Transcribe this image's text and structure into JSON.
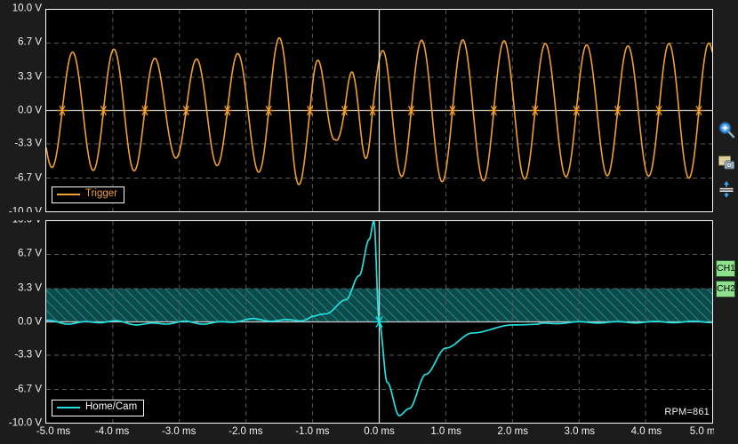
{
  "app": {
    "background_color": "#1c1c1c",
    "plot_background": "#000000"
  },
  "colors": {
    "trigger": "#f0a030",
    "home_cam": "#22e0e0",
    "grid": "#5a5a5a",
    "zero_line": "#c8c8c8",
    "cursor": "#d8d8d8",
    "band_fill": "#0d4a4a",
    "band_hatch": "#1f8c8c",
    "badge_green": "#8ee08e",
    "text": "#f2f2f2"
  },
  "axes": {
    "y_ticks": [
      "10.0 V",
      "6.7 V",
      "3.3 V",
      "0.0 V",
      "-3.3 V",
      "-6.7 V",
      "-10.0 V"
    ],
    "y_values": [
      10.0,
      6.7,
      3.3,
      0.0,
      -3.3,
      -6.7,
      -10.0
    ],
    "y_min": -10.0,
    "y_max": 10.0,
    "x_ticks": [
      "-5.0 ms",
      "-4.0 ms",
      "-3.0 ms",
      "-2.0 ms",
      "-1.0 ms",
      "0.0 ms",
      "1.0 ms",
      "2.0 ms",
      "3.0 ms",
      "4.0 ms",
      "5.0 ms"
    ],
    "x_values": [
      -5.0,
      -4.0,
      -3.0,
      -2.0,
      -1.0,
      0.0,
      1.0,
      2.0,
      3.0,
      4.0,
      5.0
    ],
    "x_min": -5.0,
    "x_max": 5.0,
    "x_unit": "ms",
    "y_unit": "V"
  },
  "cursor": {
    "position_ms": 0.0,
    "visible": true
  },
  "top_panel": {
    "legend_label": "Trigger",
    "series_name": "Trigger",
    "line_color": "#f0a030",
    "marker_symbol": "asterisk"
  },
  "bottom_panel": {
    "legend_label": "Home/Cam",
    "series_name": "Home/Cam",
    "line_color": "#22e0e0",
    "marker_symbol": "asterisk",
    "band": {
      "y_low": 0.0,
      "y_high": 3.3,
      "hatched": true
    }
  },
  "readout": {
    "rpm_label": "RPM=861",
    "rpm_value": 861
  },
  "channel_badges": [
    {
      "label": "CH1",
      "name": "ch1"
    },
    {
      "label": "CH2",
      "name": "ch2"
    }
  ],
  "sidebar_icons": [
    {
      "name": "zoom-in-icon",
      "title": "Zoom In"
    },
    {
      "name": "screenshot-icon",
      "title": "Screenshot"
    },
    {
      "name": "fit-vertical-icon",
      "title": "Fit Vertical"
    }
  ],
  "chart_data": {
    "type": "line",
    "title": "",
    "xlabel": "",
    "ylabel": "",
    "xlim": [
      -5.0,
      5.0
    ],
    "ylim": [
      -10.0,
      10.0
    ],
    "grid": true,
    "legend_position": "bottom-left",
    "panels": [
      {
        "name": "trigger-panel",
        "ylabel": "V",
        "series": [
          {
            "name": "Trigger",
            "color": "#f0a030",
            "description": "Amplitude-modulated sine, ~16 cycles over 10 ms, amplitude varying 2.5 V to 8.0 V",
            "cycles": [
              {
                "t_start": -5.0,
                "amplitude": 5.6
              },
              {
                "t_start": -4.38,
                "amplitude": 5.9
              },
              {
                "t_start": -3.76,
                "amplitude": 6.2
              },
              {
                "t_start": -3.14,
                "amplitude": 4.6
              },
              {
                "t_start": -2.52,
                "amplitude": 5.4
              },
              {
                "t_start": -1.9,
                "amplitude": 5.8
              },
              {
                "t_start": -1.28,
                "amplitude": 8.0
              },
              {
                "t_start": -0.66,
                "amplitude": 2.9
              },
              {
                "t_start": -0.34,
                "amplitude": 4.1
              },
              {
                "t_start": 0.1,
                "amplitude": 6.2
              },
              {
                "t_start": 0.72,
                "amplitude": 7.1
              },
              {
                "t_start": 1.34,
                "amplitude": 7.0
              },
              {
                "t_start": 1.96,
                "amplitude": 6.9
              },
              {
                "t_start": 2.58,
                "amplitude": 6.6
              },
              {
                "t_start": 3.2,
                "amplitude": 6.5
              },
              {
                "t_start": 3.82,
                "amplitude": 6.4
              },
              {
                "t_start": 4.44,
                "amplitude": 6.7
              }
            ],
            "zero_cross_markers_ms": [
              -4.76,
              -4.14,
              -3.52,
              -2.9,
              -2.28,
              -1.66,
              -1.04,
              -0.52,
              -0.1,
              0.48,
              1.1,
              1.72,
              2.34,
              2.96,
              3.58,
              4.2,
              4.8
            ]
          }
        ]
      },
      {
        "name": "home-cam-panel",
        "ylabel": "V",
        "series": [
          {
            "name": "Home/Cam",
            "color": "#22e0e0",
            "description": "Flat noisy baseline near 0 V, rising exponentially to +10 V peak just before 0 ms, sharp zero crossing at 0.00 ms, negative trough of -9.3 V at ~0.35 ms, then recovery to 0 V by ~2.2 ms",
            "key_points": [
              {
                "t": -5.0,
                "v": 0.0
              },
              {
                "t": -3.0,
                "v": -0.15
              },
              {
                "t": -2.0,
                "v": 0.1
              },
              {
                "t": -1.2,
                "v": 0.25
              },
              {
                "t": -0.8,
                "v": 0.8
              },
              {
                "t": -0.5,
                "v": 2.2
              },
              {
                "t": -0.3,
                "v": 4.6
              },
              {
                "t": -0.15,
                "v": 8.2
              },
              {
                "t": -0.08,
                "v": 10.0
              },
              {
                "t": 0.0,
                "v": 0.0
              },
              {
                "t": 0.12,
                "v": -6.0
              },
              {
                "t": 0.3,
                "v": -9.3
              },
              {
                "t": 0.45,
                "v": -8.6
              },
              {
                "t": 0.7,
                "v": -5.2
              },
              {
                "t": 1.0,
                "v": -2.6
              },
              {
                "t": 1.4,
                "v": -1.1
              },
              {
                "t": 2.0,
                "v": -0.3
              },
              {
                "t": 3.0,
                "v": -0.05
              },
              {
                "t": 5.0,
                "v": 0.0
              }
            ],
            "zero_cross_markers_ms": [
              0.0
            ]
          }
        ]
      }
    ]
  }
}
